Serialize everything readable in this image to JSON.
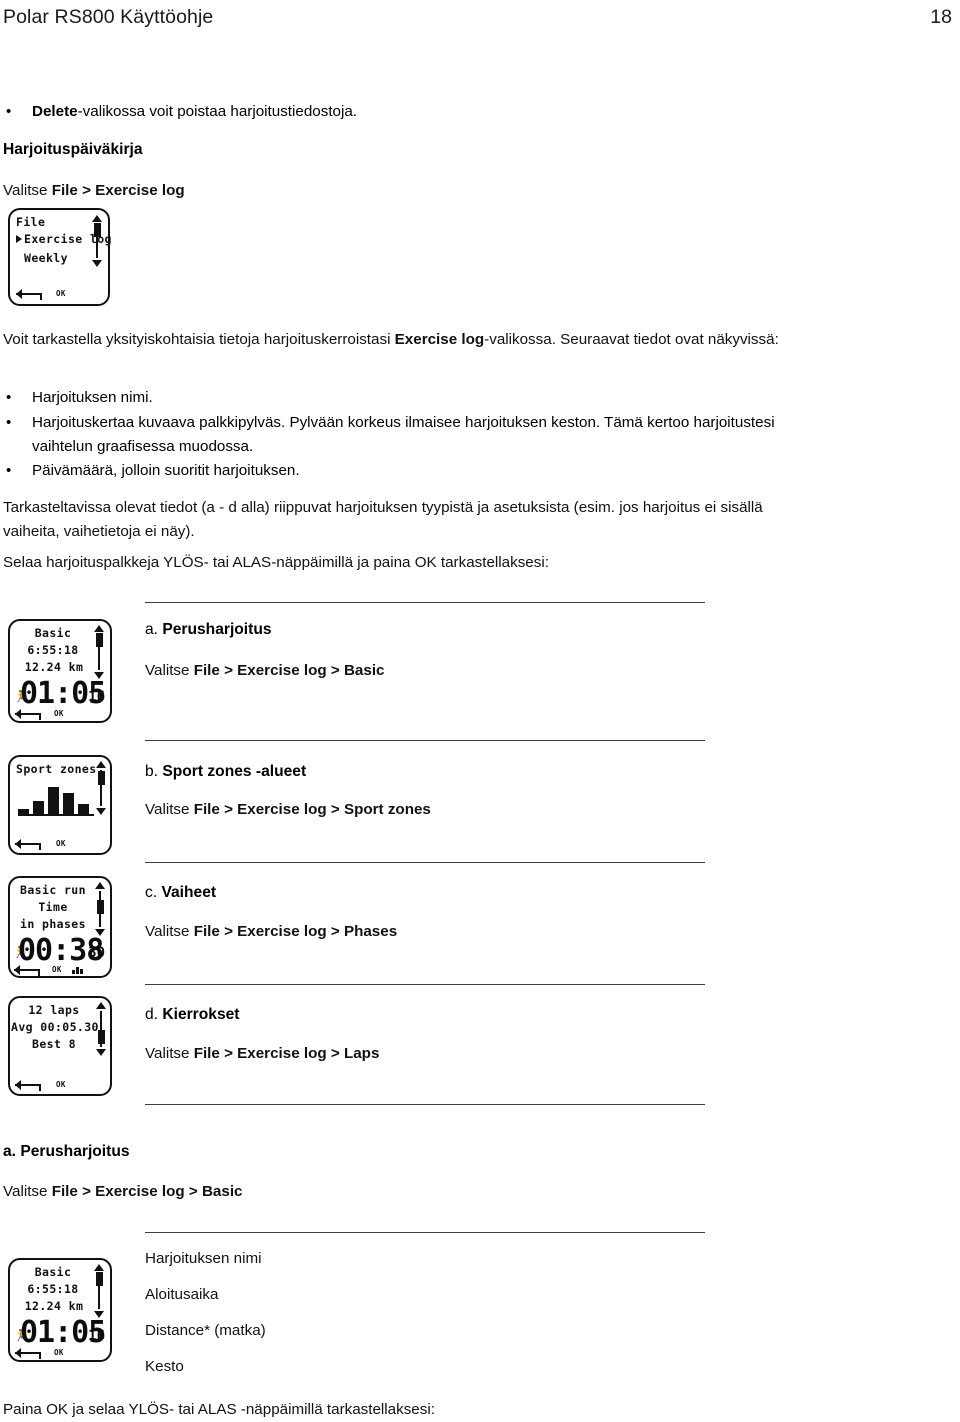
{
  "header": {
    "doc_title": "Polar RS800 Käyttöohje",
    "page_number": "18"
  },
  "intro": {
    "bullet_delete_bold": "Delete",
    "bullet_delete_rest": "-valikossa voit poistaa harjoitustiedostoja.",
    "section_heading": "Harjoituspäiväkirja",
    "select_prefix": "Valitse ",
    "select_path": "File > Exercise log"
  },
  "watch_menu": {
    "line1": "File",
    "line2": "Exercise log",
    "line3": "Weekly",
    "ok_label": "OK"
  },
  "body": {
    "paragraph1_a": "Voit tarkastella yksityiskohtaisia tietoja harjoituskerroistasi ",
    "paragraph1_bold": "Exercise log",
    "paragraph1_b": "-valikossa. Seuraavat tiedot ovat näkyvissä:",
    "bullets": [
      "Harjoituksen nimi.",
      "Harjoituskertaa kuvaava palkkipylväs. Pylvään korkeus ilmaisee harjoituksen keston. Tämä kertoo harjoitustesi vaihtelun graafisessa muodossa.",
      "Päivämäärä, jolloin suoritit harjoituksen."
    ],
    "paragraph2": "Tarkasteltavissa olevat tiedot (a - d alla) riippuvat harjoituksen tyypistä ja asetuksista (esim. jos harjoitus ei sisällä vaiheita, vaihetietoja ei näy).",
    "paragraph3": "Selaa harjoituspalkkeja YLÖS- tai ALAS-näppäimillä ja paina OK tarkastellaksesi:"
  },
  "sections": [
    {
      "letter": "a. ",
      "title": "Perusharjoitus",
      "select_prefix": "Valitse ",
      "select_path": "File > Exercise log > Basic",
      "watch": {
        "line1": "Basic",
        "line2": "6:55:18",
        "line3": "12.24 km",
        "big": "01:05",
        "corner": "16",
        "ok_label": "OK"
      }
    },
    {
      "letter": "b. ",
      "title": "Sport zones -alueet",
      "select_prefix": "Valitse ",
      "select_path": "File > Exercise log > Sport zones",
      "watch": {
        "line1": "Sport zones",
        "ok_label": "OK"
      }
    },
    {
      "letter": "c. ",
      "title": "Vaiheet",
      "select_prefix": "Valitse ",
      "select_path": "File > Exercise log > Phases",
      "watch": {
        "line1": "Basic run",
        "line2": "Time",
        "line3": "in phases",
        "big": "00:38",
        "corner": "30",
        "ok_label": "OK"
      }
    },
    {
      "letter": "d. ",
      "title": "Kierrokset",
      "select_prefix": "Valitse ",
      "select_path": "File > Exercise log > Laps",
      "watch": {
        "line1": "12 laps",
        "line2": "Avg 00:05.30",
        "line3": "Best 8",
        "ok_label": "OK"
      }
    }
  ],
  "detail": {
    "letter": "a. ",
    "title": "Perusharjoitus",
    "select_prefix": "Valitse ",
    "select_path": "File > Exercise log > Basic",
    "watch": {
      "line1": "Basic",
      "line2": "6:55:18",
      "line3": "12.24 km",
      "big": "01:05",
      "corner": "16",
      "ok_label": "OK"
    },
    "labels": [
      "Harjoituksen nimi",
      "Aloitusaika",
      "Distance* (matka)",
      "Kesto"
    ],
    "footer": "Paina OK ja selaa YLÖS- tai ALAS -näppäimillä tarkastellaksesi:"
  },
  "chart_data": {
    "type": "bar",
    "title": "Sport zones",
    "categories": [
      "1",
      "2",
      "3",
      "4",
      "5"
    ],
    "values": [
      14,
      34,
      68,
      52,
      26
    ],
    "xlabel": "",
    "ylabel": "",
    "ylim": [
      0,
      80
    ],
    "grid": false,
    "legend": "none"
  },
  "colors": {
    "ink": "#111111",
    "rule": "#3d3d3d",
    "page_bg": "#ffffff"
  }
}
